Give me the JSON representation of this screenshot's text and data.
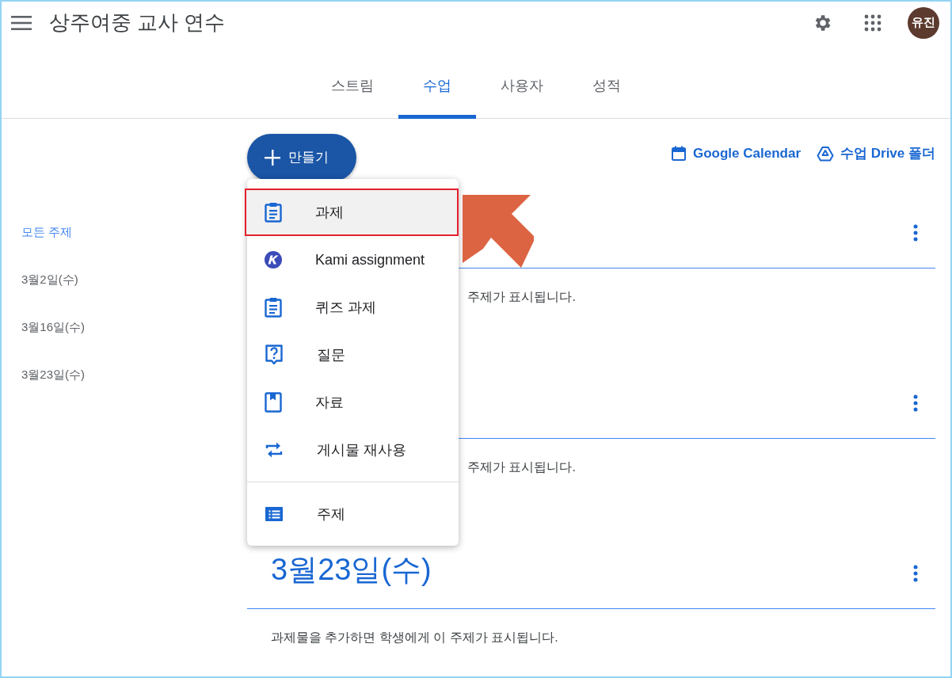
{
  "header": {
    "title": "상주여중 교사 연수",
    "avatar": "유진"
  },
  "tabs": [
    {
      "label": "스트림",
      "selected": false
    },
    {
      "label": "수업",
      "selected": true
    },
    {
      "label": "사용자",
      "selected": false
    },
    {
      "label": "성적",
      "selected": false
    }
  ],
  "create_button": {
    "label": "만들기"
  },
  "links": [
    {
      "kind": "calendar",
      "label": "Google Calendar"
    },
    {
      "kind": "drive",
      "label": "수업 Drive 폴더"
    }
  ],
  "topics": [
    {
      "label": "모든 주제",
      "selected": true
    },
    {
      "label": "3월2일(수)",
      "selected": false
    },
    {
      "label": "3월16일(수)",
      "selected": false
    },
    {
      "label": "3월23일(수)",
      "selected": false
    }
  ],
  "sections": [
    {
      "covered": true,
      "description": "주제가 표시됩니다."
    },
    {
      "covered": true,
      "description": "주제가 표시됩니다."
    },
    {
      "covered": false,
      "heading": "3월23일(수)",
      "description": "과제물을 추가하면 학생에게 이 주제가 표시됩니다."
    }
  ],
  "create_menu": {
    "items": [
      {
        "kind": "assignment",
        "label": "과제",
        "highlighted": true
      },
      {
        "kind": "kami",
        "label": "Kami assignment",
        "highlighted": false
      },
      {
        "kind": "assignment",
        "label": "퀴즈 과제",
        "highlighted": false
      },
      {
        "kind": "question",
        "label": "질문",
        "highlighted": false
      },
      {
        "kind": "material",
        "label": "자료",
        "highlighted": false
      },
      {
        "kind": "reuse",
        "label": "게시물 재사용",
        "highlighted": false
      }
    ],
    "footer_items": [
      {
        "kind": "topic",
        "label": "주제",
        "highlighted": false
      }
    ]
  },
  "pointer": {
    "kind": "arrow"
  }
}
